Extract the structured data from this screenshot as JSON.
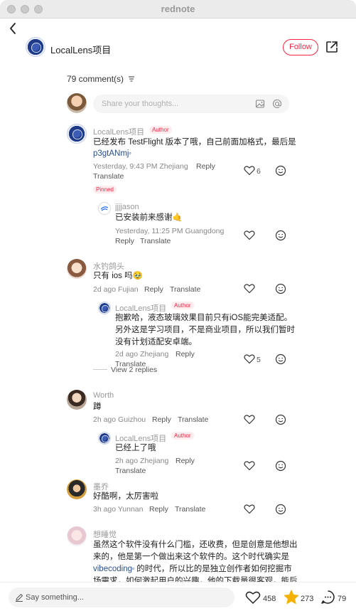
{
  "app": {
    "title": "rednote"
  },
  "header": {
    "author": "LocalLens项目",
    "follow_label": "Follow"
  },
  "comments_header": {
    "count": "79 comment(s)"
  },
  "composer": {
    "placeholder": "Share your thoughts..."
  },
  "comments": [
    {
      "user": "LocalLens项目",
      "badge": "Author",
      "text1": "已经发布 TestFlight 版本了哦，自己前面加格式，最后是",
      "link": "p3gtANmj",
      "meta": "Yesterday, 9:43 PM Zhejiang",
      "reply": "Reply",
      "translate": "Translate",
      "likes": "6",
      "pinned": "Pinned"
    },
    {
      "user": "jjjjason",
      "text": "已安装前来感谢🤙",
      "meta": "Yesterday, 11:25 PM Guangdong",
      "reply": "Reply",
      "translate": "Translate"
    },
    {
      "user": "水钓鸽头",
      "text": "只有 ios 吗🥹",
      "meta": "2d ago Fujian",
      "reply": "Reply",
      "translate": "Translate"
    },
    {
      "user": "LocalLens项目",
      "badge": "Author",
      "text1": "抱歉哈，液态玻璃效果目前只有iOS能完美适配。",
      "text2": "另外这是学习项目，不是商业项目，所以我们暂时",
      "text3": "没有计划适配安卓端。",
      "meta": "2d ago Zhejiang",
      "reply": "Reply",
      "translate": "Translate",
      "likes": "5",
      "view_replies": "View 2 replies"
    },
    {
      "user": "Worth",
      "text": "蹲",
      "meta": "2h ago Guizhou",
      "reply": "Reply",
      "translate": "Translate"
    },
    {
      "user": "LocalLens项目",
      "badge": "Author",
      "text": "已经上了哦",
      "meta": "2h ago Zhejiang",
      "reply": "Reply",
      "translate": "Translate"
    },
    {
      "user": "墨乔",
      "text": "好酷啊，太厉害啦",
      "meta": "3h ago Yunnan",
      "reply": "Reply",
      "translate": "Translate"
    },
    {
      "user": "想睡觉",
      "text1": "虽然这个软件没有什么门槛，还收费，但是创意是他想出",
      "text2": "来的，他是第一个做出来这个软件的。这个时代确实是",
      "link": "vibecoding",
      "text3": " 的时代，所以比的是独立创作者如何挖掘市",
      "text4": "场需求，如何激起用户的兴趣，他的下载量很客观，能后"
    }
  ],
  "bottom_bar": {
    "placeholder": "Say something...",
    "likes": "458",
    "stars": "273",
    "comments": "79"
  }
}
